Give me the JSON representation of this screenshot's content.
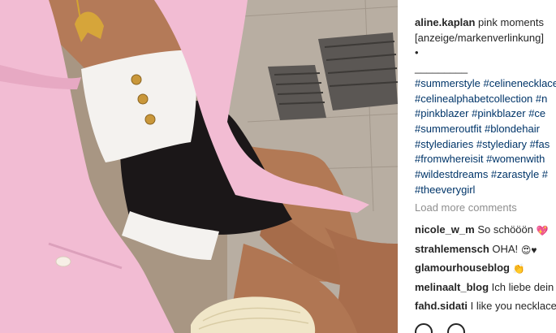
{
  "photo": {
    "description_icon": "photo"
  },
  "post": {
    "author": "aline.kaplan",
    "caption_lines": [
      "pink moments",
      "[anzeige/markenverlinkung]",
      "•",
      "_________"
    ],
    "hashtag_lines": [
      "#summerstyle #celinenecklace",
      "#celinealphabetcollection #n",
      "#pinkblazer #pinkblazer #ce",
      "#summeroutfit #blondehair",
      "#stylediaries #stylediary #fas",
      "#fromwhereisit #womenwith",
      "#wildestdreams #zarastyle #",
      "#theeverygirl"
    ]
  },
  "load_more_label": "Load more comments",
  "comments": [
    {
      "author": "nicole_w_m",
      "text": "So schööön",
      "emoji": "💖"
    },
    {
      "author": "strahlemensch",
      "text": "OHA!",
      "emoji": "😍♥"
    },
    {
      "author": "glamourhouseblog",
      "text": "",
      "emoji": "👏"
    },
    {
      "author": "melinaalt_blog",
      "text": "Ich liebe dein",
      "emoji": ""
    },
    {
      "author": "fahd.sidati",
      "text": "I like you necklace",
      "emoji": ""
    }
  ],
  "actions": {
    "like_icon": "heart-icon",
    "comment_icon": "comment-icon"
  },
  "colors": {
    "hashtag": "#003569",
    "muted": "#8e8e8e",
    "text": "#262626",
    "blazer": "#f2bcd3"
  }
}
